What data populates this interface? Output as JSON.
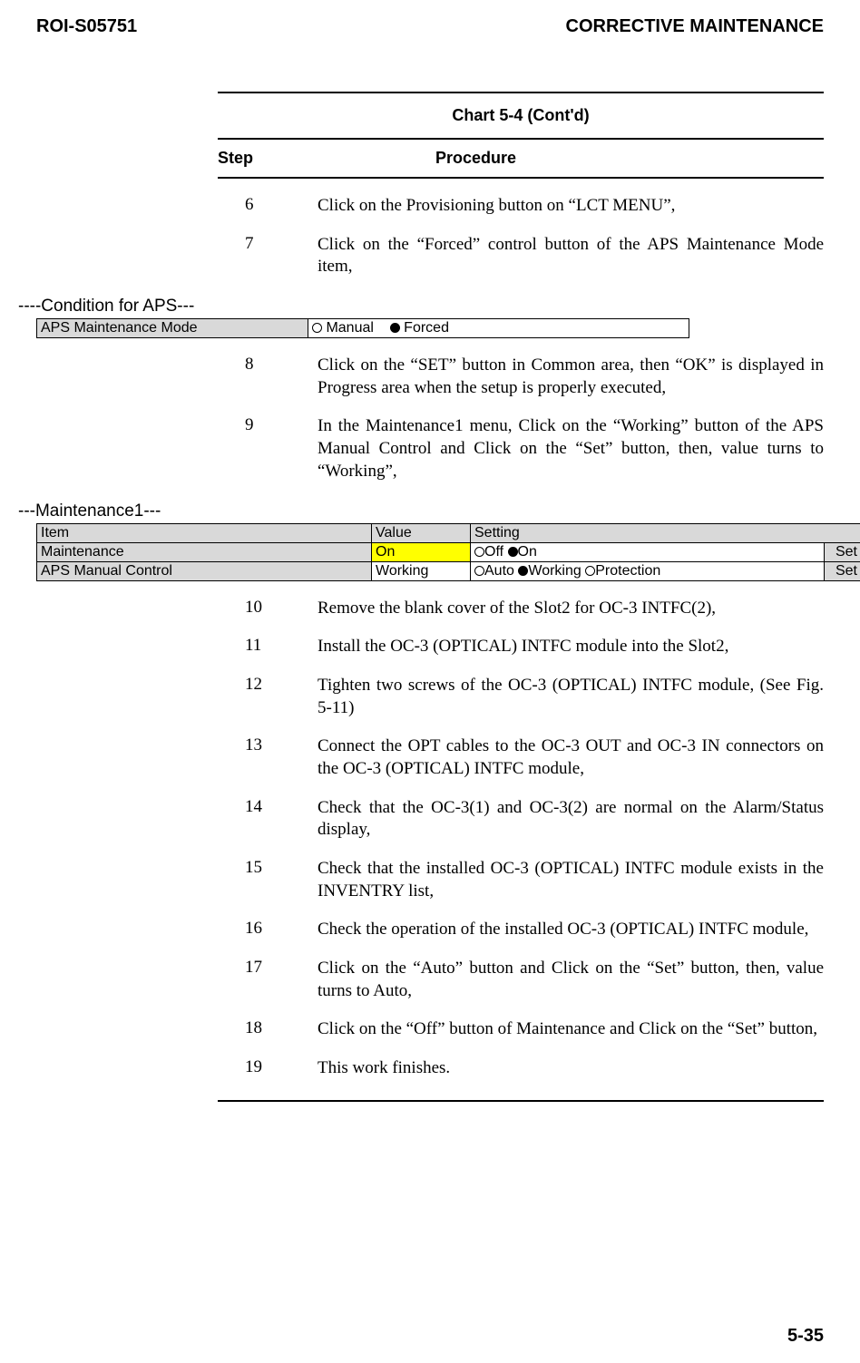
{
  "header": {
    "doc_id": "ROI-S05751",
    "section": "CORRECTIVE MAINTENANCE"
  },
  "chart": {
    "title": "Chart 5-4  (Cont'd)",
    "step_label": "Step",
    "procedure_label": "Procedure"
  },
  "steps_a": [
    {
      "num": "6",
      "text": "Click on the Provisioning button on “LCT MENU”,"
    },
    {
      "num": "7",
      "text": "Click on the “Forced” control button of the APS Maintenance Mode item,"
    }
  ],
  "cond_aps": {
    "heading": "----Condition for APS---",
    "row_label": "APS Maintenance Mode",
    "manual": "Manual",
    "forced": "Forced"
  },
  "steps_b": [
    {
      "num": "8",
      "text": "Click on the “SET” button in Common area, then “OK” is displayed in Progress area when the setup is properly executed,"
    },
    {
      "num": "9",
      "text": "In the Maintenance1 menu, Click on the “Working” button of the APS Manual Control and Click on the “Set” button, then, value turns to “Working”,"
    }
  ],
  "maint1": {
    "heading": "---Maintenance1---",
    "cols": {
      "item": "Item",
      "value": "Value",
      "setting": "Setting"
    },
    "row1": {
      "item": "Maintenance",
      "value": "On",
      "off": "Off",
      "on": "On",
      "set": "Set"
    },
    "row2": {
      "item": "APS Manual Control",
      "value": "Working",
      "auto": "Auto",
      "working": "Working",
      "protection": "Protection",
      "set": "Set"
    }
  },
  "steps_c": [
    {
      "num": "10",
      "text": "Remove the blank cover of the Slot2 for OC-3 INTFC(2),"
    },
    {
      "num": "11",
      "text": "Install the OC-3 (OPTICAL) INTFC module into the Slot2,"
    },
    {
      "num": "12",
      "text": "Tighten two screws of the OC-3 (OPTICAL) INTFC module, (See Fig. 5-11)"
    },
    {
      "num": "13",
      "text": "Connect the OPT cables to the OC-3 OUT and OC-3 IN connectors on the OC-3 (OPTICAL) INTFC module,"
    },
    {
      "num": "14",
      "text": "Check that the OC-3(1) and OC-3(2) are normal on the Alarm/Status display,"
    },
    {
      "num": "15",
      "text": "Check that the installed OC-3 (OPTICAL) INTFC module exists in the INVENTRY list,"
    },
    {
      "num": "16",
      "text": "Check the operation of the installed OC-3 (OPTICAL) INTFC module,"
    },
    {
      "num": "17",
      "text": "Click on the “Auto” button and Click on the “Set” button, then, value turns to Auto,"
    },
    {
      "num": "18",
      "text": "Click on the “Off” button of Maintenance and Click on the “Set” button,"
    },
    {
      "num": "19",
      "text": "This work finishes."
    }
  ],
  "page_number": "5-35"
}
